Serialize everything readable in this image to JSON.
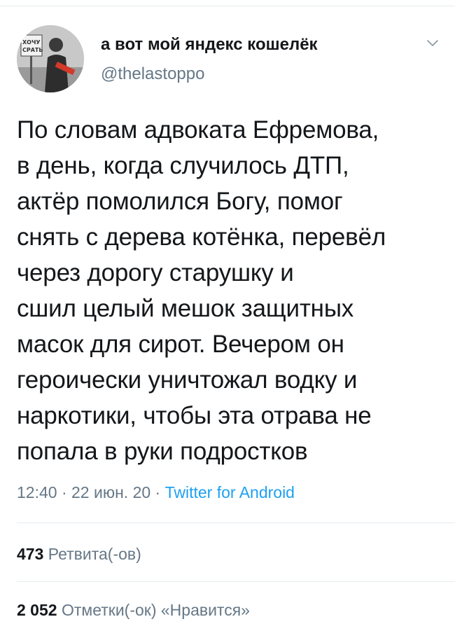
{
  "author": {
    "display_name": "а вот мой яндекс кошелёк",
    "handle": "@thelastoppo",
    "avatar_sign_text": "ХОЧУ СРАТЬ"
  },
  "tweet": {
    "text": "По словам адвоката Ефремова,\nв день, когда случилось ДТП,\nактёр помолился Богу, помог\nснять с дерева котёнка, перевёл\nчерез дорогу старушку и\nсшил целый мешок защитных\nмасок для сирот. Вечером он\nгероически уничтожал водку и\nнаркотики, чтобы эта отрава не\nпопала в руки подростков",
    "time": "12:40",
    "date": "22 июн. 20",
    "separator": "·",
    "source": "Twitter for Android"
  },
  "stats": {
    "retweets_count": "473",
    "retweets_label": "Ретвита(-ов)",
    "likes_count": "2 052",
    "likes_label": "Отметки(-ок) «Нравится»"
  },
  "icons": {
    "caret": "chevron-down-icon"
  },
  "colors": {
    "text": "#14171a",
    "secondary": "#657786",
    "link": "#1da1f2",
    "divider": "#e6ecf0"
  }
}
